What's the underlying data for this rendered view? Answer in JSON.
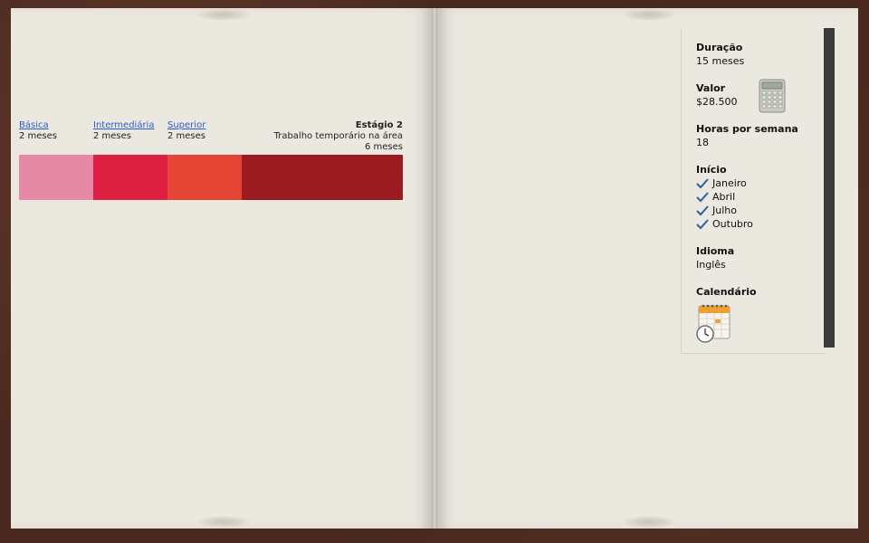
{
  "phases": [
    {
      "name": "Básica",
      "duration": "2 meses",
      "color": "#e589a7"
    },
    {
      "name": "Intermediária",
      "duration": "2 meses",
      "color": "#dd1f41"
    },
    {
      "name": "Superior",
      "duration": "2 meses",
      "color": "#e44534"
    },
    {
      "name": "Estágio 2",
      "subtitle": "Trabalho temporário na área",
      "duration": "6 meses",
      "color": "#9b1b20"
    }
  ],
  "info": {
    "duracao_label": "Duração",
    "duracao_value": "15 meses",
    "valor_label": "Valor",
    "valor_value": "$28.500",
    "horas_label": "Horas por semana",
    "horas_value": "18",
    "inicio_label": "Início",
    "inicio_options": [
      "Janeiro",
      "Abril",
      "Julho",
      "Outubro"
    ],
    "idioma_label": "Idioma",
    "idioma_value": "Inglês",
    "calendario_label": "Calendário"
  },
  "icons": {
    "calculator": "calculator-icon",
    "check": "check-icon",
    "calendar": "calendar-clock-icon"
  }
}
